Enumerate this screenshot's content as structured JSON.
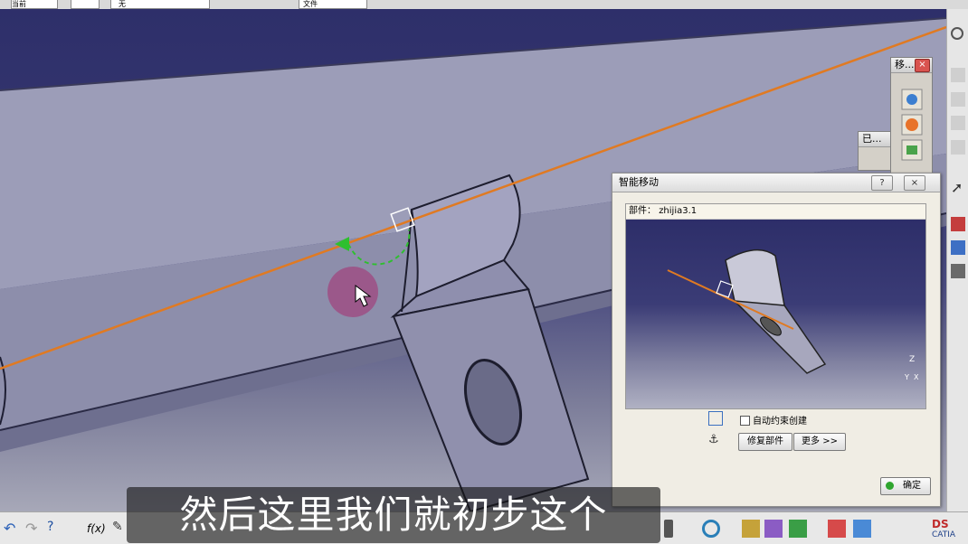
{
  "top_toolbar": {
    "combo_1": "当前",
    "combo_2": "无",
    "combo_3": "文件"
  },
  "mini_panel_move": {
    "title": "移...",
    "close": "×"
  },
  "mini_panel_constraint": {
    "title": "已..."
  },
  "dialog": {
    "title": "智能移动",
    "help_button": "?",
    "close_button": "×",
    "part_label": "部件：",
    "part_value": "zhijia3.1",
    "checkbox_label": "自动约束创建",
    "checkbox_checked": false,
    "repair_button": "修复部件",
    "more_button": "更多 >>",
    "ok_button": "确定",
    "axis_z": "Z",
    "axis_x": "X",
    "axis_y": "Y"
  },
  "bottom_toolbar": {
    "formula_label": "f(x)",
    "logo_ds": "DS",
    "logo_catia": "CATIA"
  },
  "subtitle": "然后这里我们就初步这个",
  "icons": [
    "compass-icon",
    "select-arrow-icon",
    "snap-icon",
    "manipulate-icon",
    "explode-icon",
    "update-icon",
    "undo-icon",
    "redo-icon",
    "help-icon",
    "formula-icon",
    "comment-icon",
    "catia-logo-icon"
  ],
  "colors": {
    "viewport_top": "#2e2f6a",
    "viewport_bottom": "#a7a8b8",
    "axis_line": "#e07a22",
    "compass_green": "#2fbf2f",
    "cursor_highlight": "#a0457f"
  }
}
